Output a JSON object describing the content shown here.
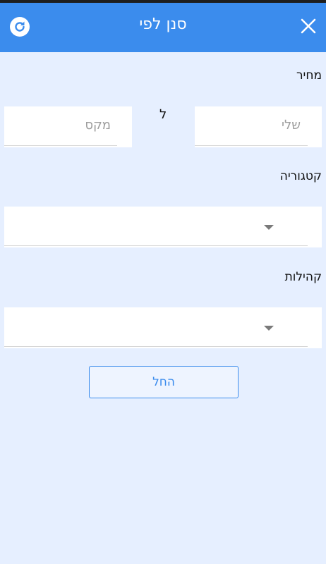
{
  "header": {
    "title": "סנן לפי",
    "refresh_icon": "refresh-icon",
    "close_icon": "close-icon",
    "color": "#3b8ced"
  },
  "price": {
    "label": "מחיר",
    "min_placeholder": "שלי",
    "to_label": "ל",
    "max_placeholder": "מקס"
  },
  "category": {
    "label": "קטגוריה",
    "selected": ""
  },
  "communities": {
    "label": "קהילות",
    "selected": ""
  },
  "actions": {
    "start_label": "החל"
  },
  "colors": {
    "background": "#e6efff",
    "accent": "#3b8ced"
  }
}
